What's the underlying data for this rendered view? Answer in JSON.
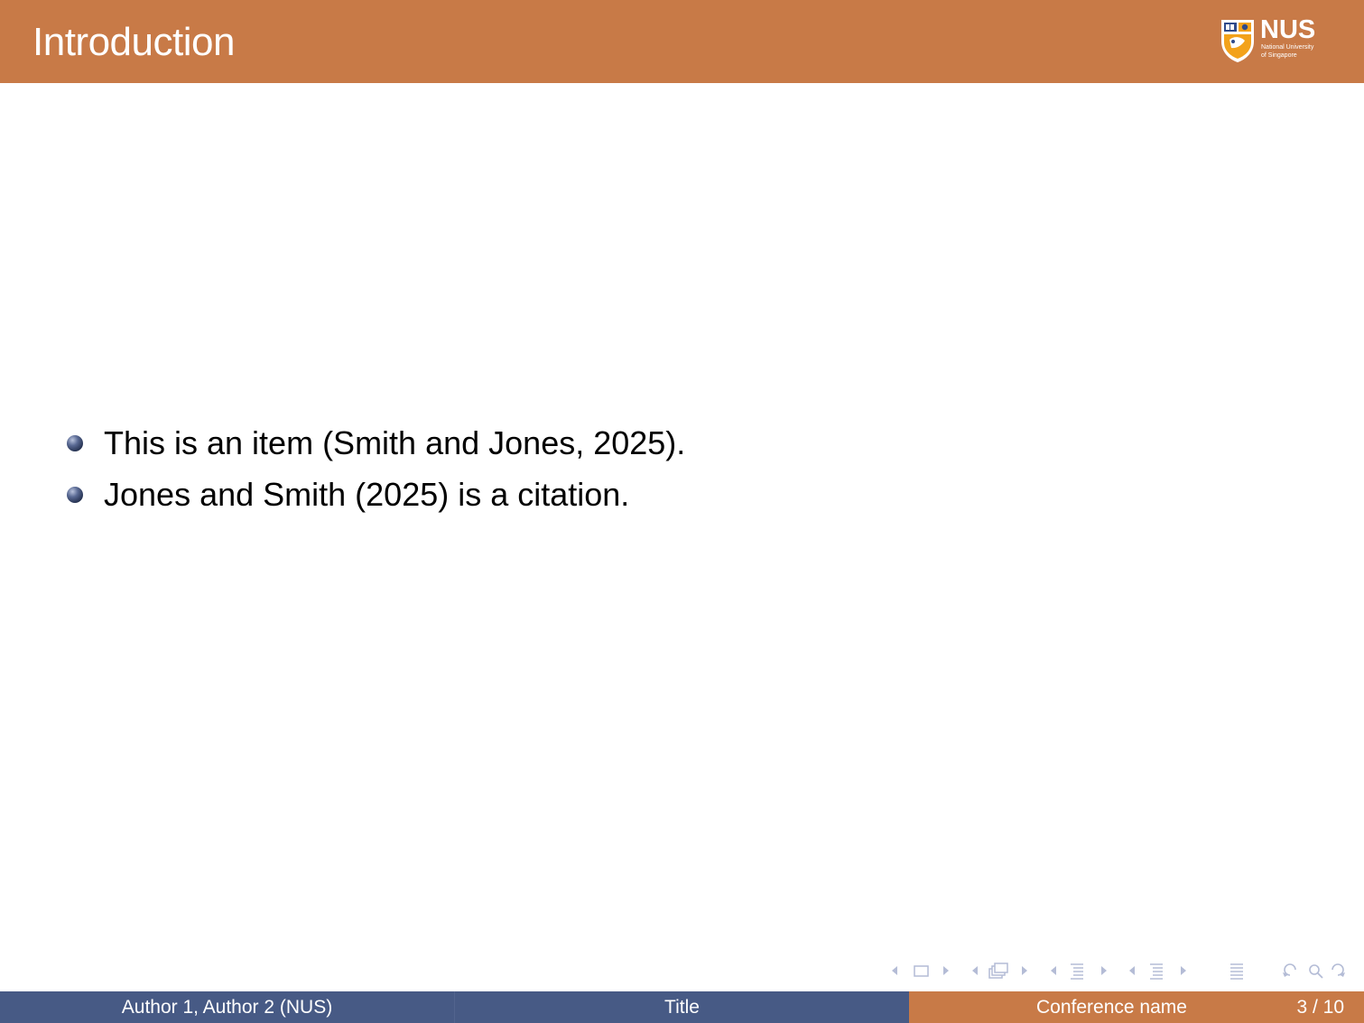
{
  "header": {
    "frame_title": "Introduction",
    "logo": {
      "wordmark": "NUS",
      "subtitle_line1": "National University",
      "subtitle_line2": "of Singapore"
    },
    "bar_color": "#c87a47"
  },
  "content": {
    "items": [
      {
        "text": "This is an item (Smith and Jones, 2025)."
      },
      {
        "text": "Jones and Smith (2025) is a citation."
      }
    ]
  },
  "navigation": {
    "icons": [
      "arrow-left-icon",
      "frame-icon",
      "arrow-right-icon",
      "arrow-left-icon",
      "subsection-icon",
      "arrow-right-icon",
      "arrow-left-icon",
      "section-icon",
      "arrow-right-icon",
      "arrow-left-icon",
      "document-icon",
      "arrow-right-icon",
      "align-icon",
      "undo-icon",
      "search-icon",
      "redo-icon"
    ]
  },
  "footer": {
    "author": "Author 1, Author 2  (NUS)",
    "title": "Title",
    "conference": "Conference name",
    "page": "3 / 10",
    "colors": {
      "left": "#475a85",
      "right": "#c87a47"
    }
  }
}
